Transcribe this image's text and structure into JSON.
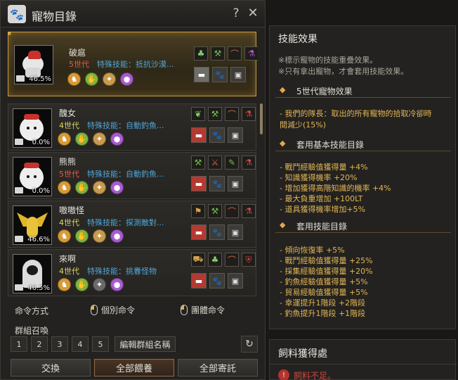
{
  "window": {
    "title": "寵物目錄",
    "help_label": "?",
    "close_label": "✕"
  },
  "pets": [
    {
      "name": "破扈",
      "generation": "5世代",
      "special_skill": "特殊技能：抵抗沙漠...",
      "progress": "46.5%",
      "selected": true,
      "skill_colors": [
        "orange",
        "green",
        "tan",
        "purple"
      ]
    },
    {
      "name": "醜女",
      "generation": "4世代",
      "special_skill": "特殊技能：自動釣魚...",
      "progress": "0.0%",
      "selected": false,
      "skill_colors": [
        "orange",
        "green",
        "tan",
        "purple"
      ]
    },
    {
      "name": "熊熊",
      "generation": "5世代",
      "special_skill": "特殊技能：自動釣魚...",
      "progress": "0.0%",
      "selected": false,
      "skill_colors": [
        "orange",
        "green",
        "tan",
        "purple"
      ]
    },
    {
      "name": "嗷嗷怪",
      "generation": "4世代",
      "special_skill": "特殊技能：探測敵對...",
      "progress": "46.6%",
      "selected": false,
      "skill_colors": [
        "orange",
        "green",
        "tan",
        "purple"
      ]
    },
    {
      "name": "來啊",
      "generation": "4世代",
      "special_skill": "特殊技能：挑釁怪物",
      "progress": "46.5%",
      "selected": false,
      "skill_colors": [
        "orange",
        "green",
        "gray",
        "purple"
      ]
    }
  ],
  "command": {
    "label": "命令方式",
    "individual": "個別命令",
    "group": "團體命令"
  },
  "group_summon": {
    "label": "群組召喚",
    "buttons": [
      "1",
      "2",
      "3",
      "4",
      "5"
    ],
    "edit_label": "編輯群組名稱",
    "refresh_icon": "↻"
  },
  "bottom_buttons": {
    "exchange": "交換",
    "feed_all": "全部餵養",
    "store_all": "全部寄託"
  },
  "effects": {
    "title": "技能效果",
    "note1": "※標示寵物的技能重疊效果。",
    "note2": "※只有拿出寵物，才會套用技能效果。",
    "section1": "5世代寵物效果",
    "gen5_line1": "- 我們的隊長：取出的所有寵物的拾取冷卻時",
    "gen5_line2": "  間減少(15%)",
    "section2": "套用基本技能目錄",
    "basic": [
      "- 戰鬥經驗值獲得量 +4%",
      "- 知識獲得機率 +20%",
      "- 增加獲得高階知識的機率 +4%",
      "- 最大負重增加 +100LT",
      "- 道具獲得機率增加+5%"
    ],
    "section3": "套用技能目錄",
    "skills": [
      "- 傾向恢復率 +5%",
      "- 戰鬥經驗值獲得量 +25%",
      "- 採集經驗值獲得量 +20%",
      "- 釣魚經驗值獲得量 +5%",
      "- 貿易經驗值獲得量 +5%",
      "- 幸運提升1階段 +2階段",
      "- 釣魚提升1階段 +1階段"
    ]
  },
  "feed_panel": {
    "title": "飼料獲得處",
    "status": "飼料不足。"
  }
}
